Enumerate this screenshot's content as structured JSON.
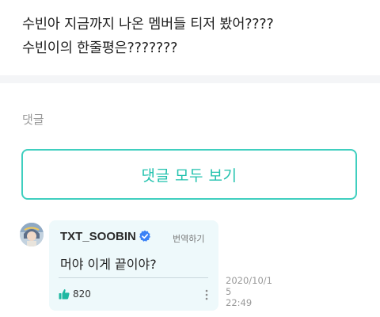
{
  "post": {
    "lines": [
      "수빈아 지금까지 나온 멤버들 티저 봤어????",
      "수빈이의 한줄평은???????"
    ]
  },
  "comments_section": {
    "label": "댓글",
    "view_all_label": "댓글 모두 보기"
  },
  "comment": {
    "author": "TXT_SOOBIN",
    "verified_icon": "verified-check-icon",
    "translate_label": "번역하기",
    "body": "머야 이게 끝이야?",
    "likes": "820",
    "timestamp_lines": [
      "2020/10/1",
      "5",
      "22:49"
    ]
  },
  "colors": {
    "accent": "#22c2ae",
    "button_border": "#3fcfbf",
    "bubble_bg": "#eef9fb",
    "verified": "#3b82f6",
    "muted_text": "#9a9a9a"
  }
}
